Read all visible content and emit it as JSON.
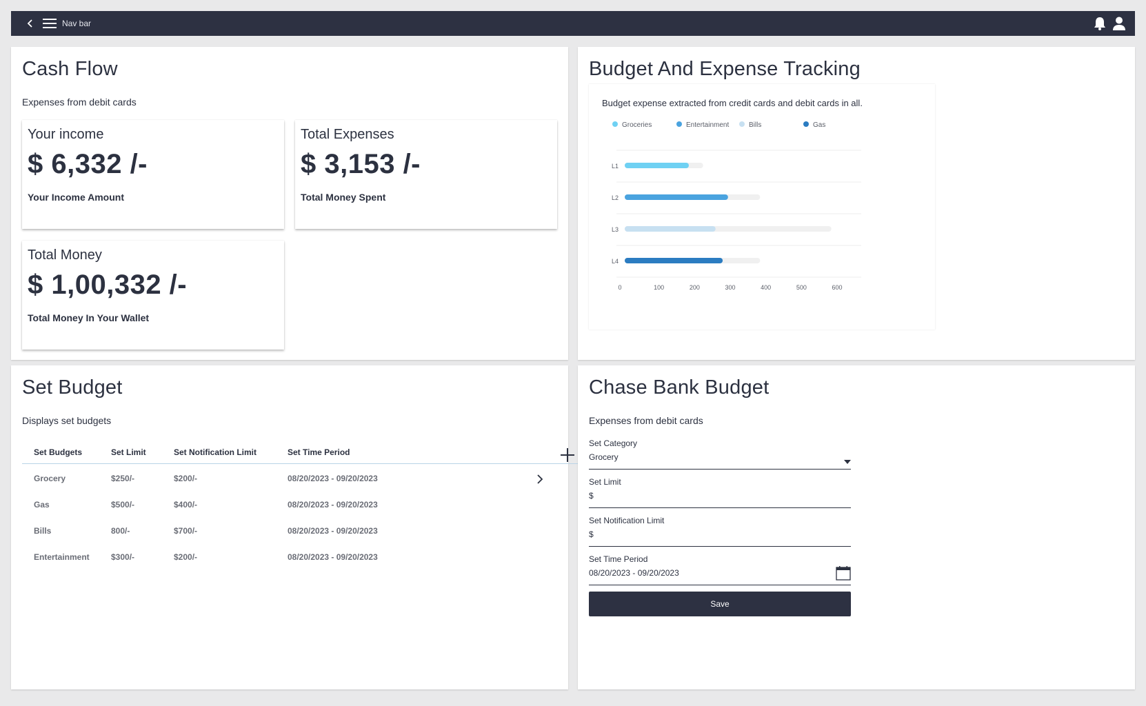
{
  "navbar": {
    "title": "Nav bar"
  },
  "cash_flow": {
    "title": "Cash Flow",
    "subtitle": "Expenses from debit cards",
    "income": {
      "label": "Your income",
      "value": "$ 6,332 /-",
      "desc": "Your Income Amount"
    },
    "expenses": {
      "label": "Total Expenses",
      "value": "$ 3,153 /-",
      "desc": "Total Money Spent"
    },
    "money": {
      "label": "Total Money",
      "value": "$ 1,00,332 /-",
      "desc": "Total Money In Your Wallet"
    }
  },
  "budget_tracking": {
    "title": "Budget And Expense Tracking",
    "caption": "Budget expense extracted from credit cards and debit cards in all."
  },
  "chart_data": {
    "type": "bar",
    "orientation": "horizontal",
    "categories": [
      "L1",
      "L2",
      "L3",
      "L4"
    ],
    "series": [
      {
        "name": "Groceries",
        "value": 180,
        "track": 220,
        "color": "#6fd1f3"
      },
      {
        "name": "Entertainment",
        "value": 290,
        "track": 380,
        "color": "#4aa3df"
      },
      {
        "name": "Bills",
        "value": 255,
        "track": 580,
        "color": "#c7e0f1"
      },
      {
        "name": "Gas",
        "value": 275,
        "track": 380,
        "color": "#2b7cc1"
      }
    ],
    "xticks": [
      0,
      100,
      200,
      300,
      400,
      500,
      600
    ],
    "xlim": [
      0,
      600
    ],
    "grid": true,
    "legend_position": "top"
  },
  "set_budget": {
    "title": "Set Budget",
    "subtitle": "Displays set budgets",
    "columns": [
      "Set Budgets",
      "Set Limit",
      "Set Notification Limit",
      "Set Time Period"
    ],
    "rows": [
      [
        "Grocery",
        "$250/-",
        "$200/-",
        "08/20/2023 - 09/20/2023"
      ],
      [
        "Gas",
        "$500/-",
        "$400/-",
        "08/20/2023 - 09/20/2023"
      ],
      [
        "Bills",
        "800/-",
        "$700/-",
        "08/20/2023 - 09/20/2023"
      ],
      [
        "Entertainment",
        "$300/-",
        "$200/-",
        "08/20/2023 - 09/20/2023"
      ]
    ]
  },
  "chase": {
    "title": "Chase Bank Budget",
    "subtitle": "Expenses from debit cards",
    "category_label": "Set Category",
    "category_value": "Grocery",
    "limit_label": "Set Limit",
    "limit_value": "$",
    "notif_label": "Set Notification Limit",
    "notif_value": "$",
    "period_label": "Set Time Period",
    "period_value": "08/20/2023 - 09/20/2023",
    "save_label": "Save"
  },
  "icons": [
    "back-icon",
    "menu-icon",
    "bell-icon",
    "user-icon",
    "plus-icon",
    "chevron-right-icon",
    "dropdown-arrow-icon",
    "calendar-icon"
  ]
}
